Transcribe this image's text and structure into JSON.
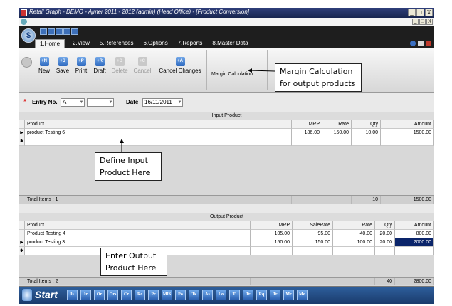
{
  "window": {
    "title": "Retail Graph - DEMO - Ajmer  2011 - 2012 (admin) (Head Office)  - [Product Conversion]",
    "buttons": [
      "_",
      "□",
      "X"
    ],
    "mdi_buttons": [
      "_",
      "□",
      "X"
    ]
  },
  "ribbon": {
    "app_button": "$",
    "tabs": [
      "1.Home",
      "2.View",
      "5.References",
      "6.Options",
      "7.Reports",
      "8.Master Data"
    ],
    "buttons": [
      {
        "icon": "new-icon",
        "glyph": "+N",
        "label": "New",
        "enabled": true
      },
      {
        "icon": "save-icon",
        "glyph": "+S",
        "label": "Save",
        "enabled": true
      },
      {
        "icon": "print-icon",
        "glyph": "+P",
        "label": "Print",
        "enabled": true
      },
      {
        "icon": "draft-icon",
        "glyph": "+R",
        "label": "Draft",
        "enabled": true
      },
      {
        "icon": "delete-icon",
        "glyph": "+D",
        "label": "Delete",
        "enabled": false
      },
      {
        "icon": "cancel-icon",
        "glyph": "+C",
        "label": "Cancel",
        "enabled": false
      },
      {
        "icon": "cancel-changes-icon",
        "glyph": "+A",
        "label": "Cancel Changes",
        "enabled": true
      }
    ],
    "margin_button": "Margin Calculation"
  },
  "entry": {
    "entry_no_label": "Entry No.",
    "entry_no_value": "A",
    "date_label": "Date",
    "date_value": "16/11/2011"
  },
  "input_grid": {
    "title": "Input Product",
    "columns": [
      "Product",
      "MRP",
      "Rate",
      "Qty",
      "Amount"
    ],
    "rows": [
      {
        "product": "product Testing 6",
        "mrp": "186.00",
        "rate": "150.00",
        "qty": "10.00",
        "amount": "1500.00"
      }
    ],
    "footer_label": "Total Items : 1",
    "footer_qty": "10",
    "footer_amount": "1500.00"
  },
  "output_grid": {
    "title": "Output Product",
    "columns": [
      "Product",
      "MRP",
      "SaleRate",
      "Rate",
      "Qty",
      "Amount"
    ],
    "rows": [
      {
        "product": "Product Testing 4",
        "mrp": "105.00",
        "salerate": "95.00",
        "rate": "40.00",
        "qty": "20.00",
        "amount": "800.00"
      },
      {
        "product": "product Testing 3",
        "mrp": "150.00",
        "salerate": "150.00",
        "rate": "100.00",
        "qty": "20.00",
        "amount": "2000.00"
      }
    ],
    "footer_label": "Total Items : 2",
    "footer_qty": "40",
    "footer_amount": "2800.00"
  },
  "callouts": {
    "margin_line1": "Margin Calculation",
    "margin_line2": "for output products",
    "input_line1": "Define Input",
    "input_line2": "Product Here",
    "output_line1": "Enter Output",
    "output_line2": "Product Here"
  },
  "taskbar": {
    "start_label": "Start",
    "items": [
      "Is",
      "Ir",
      "Or",
      "Ors",
      "Cr",
      "Rc",
      "Pr",
      "MIS",
      "Po",
      "Ts",
      "As",
      "Lo",
      "Ti",
      "Tr",
      "Rq",
      "Tr",
      "Mr",
      "Mo"
    ]
  }
}
